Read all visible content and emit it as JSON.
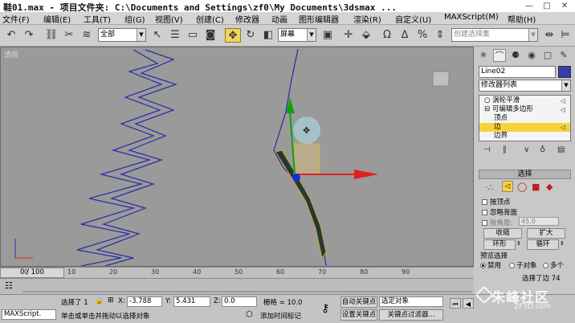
{
  "window": {
    "title": "鞋01.max   - 项目文件夹: C:\\Documents and Settings\\zf0\\My Documents\\3dsmax  ...",
    "minimize": "—",
    "maximize": "□",
    "close": "✕"
  },
  "menu": [
    "文件(F)",
    "编辑(E)",
    "工具(T)",
    "组(G)",
    "视图(V)",
    "创建(C)",
    "修改器",
    "动画",
    "图形编辑器",
    "渲染(R)",
    "自定义(U)",
    "MAXScript(M)",
    "帮助(H)"
  ],
  "toolbar": {
    "selection_filter": "全部",
    "ref_coord": "屏幕",
    "named_selection": "创建选择集"
  },
  "viewport": {
    "label": "透视"
  },
  "ruler_ticks": [
    "0",
    "10",
    "20",
    "30",
    "40",
    "50",
    "60",
    "70",
    "80",
    "90"
  ],
  "timeslider": "0 / 100",
  "command_panel": {
    "object_name": "Line02",
    "modifier_list": "修改器列表",
    "stack": [
      {
        "label": "涡轮平滑",
        "indent": 0,
        "selected": false,
        "prefix": "○"
      },
      {
        "label": "可编辑多边形",
        "indent": 0,
        "selected": false,
        "prefix": "⊟"
      },
      {
        "label": "顶点",
        "indent": 1,
        "selected": false,
        "prefix": ""
      },
      {
        "label": "边",
        "indent": 1,
        "selected": true,
        "prefix": ""
      },
      {
        "label": "边界",
        "indent": 1,
        "selected": false,
        "prefix": ""
      }
    ],
    "selection_rollout": {
      "header": "选择",
      "by_vertex": "按顶点",
      "ignore_backfacing": "忽略背面",
      "by_angle": "按角度:",
      "angle_value": "45.0",
      "shrink": "收缩",
      "grow": "扩大",
      "ring": "环形",
      "loop": "循环",
      "preview": "预览选择",
      "preview_off": "禁用",
      "preview_subobj": "子对象",
      "preview_multi": "多个",
      "selected_count": "选择了边 74"
    }
  },
  "status": {
    "selected_objects": "选择了 1",
    "x_value": "-3.788",
    "y_value": "5.431",
    "z_value": "0.0",
    "grid": "栅格 = 10.0",
    "auto_key": "自动关键点",
    "selected_mode": "选定对象",
    "set_key": "设置关键点",
    "key_filters": "关键点过滤器...",
    "prompt": "单击或单击并拖动以选择对象",
    "add_time_tag": "添加时间标记",
    "maxscript": "MAXScript."
  },
  "watermark": {
    "brand": "朱峰社区",
    "url": "ZF3D.com"
  },
  "colors": {
    "viewport_bg": "#9a9a9a",
    "wire": "#2a2aa8",
    "selected_stack": "#f6d33a",
    "axis_x": "#e02020",
    "axis_y": "#10a010"
  }
}
